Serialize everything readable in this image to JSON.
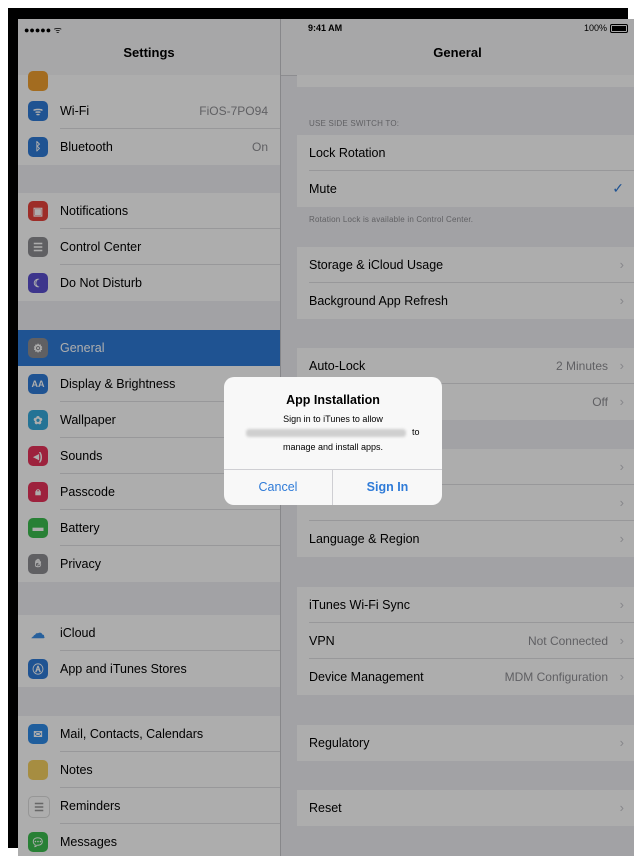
{
  "status": {
    "time": "9:41 AM",
    "battery": "100%"
  },
  "sidebar": {
    "title": "Settings",
    "wifi": {
      "label": "Wi-Fi",
      "value": "FiOS-7PO94"
    },
    "bluetooth": {
      "label": "Bluetooth",
      "value": "On"
    },
    "notifications": "Notifications",
    "control_center": "Control Center",
    "do_not_disturb": "Do Not Disturb",
    "general": "General",
    "display": "Display & Brightness",
    "wallpaper": "Wallpaper",
    "sounds": "Sounds",
    "passcode": "Passcode",
    "battery": "Battery",
    "privacy": "Privacy",
    "icloud": "iCloud",
    "app_stores": "App and iTunes Stores",
    "mail": "Mail, Contacts, Calendars",
    "notes": "Notes",
    "reminders": "Reminders",
    "messages": "Messages"
  },
  "main": {
    "title": "General",
    "side_switch_caption": "USE SIDE SWITCH TO:",
    "lock_rotation": "Lock Rotation",
    "mute": "Mute",
    "rotation_note": "Rotation Lock is available in Control Center.",
    "storage": "Storage & iCloud Usage",
    "background_refresh": "Background App Refresh",
    "auto_lock": {
      "label": "Auto-Lock",
      "value": "2 Minutes"
    },
    "restrictions": {
      "value": "Off"
    },
    "language": "Language & Region",
    "itunes_sync": "iTunes Wi-Fi Sync",
    "vpn": {
      "label": "VPN",
      "value": "Not Connected"
    },
    "device_mgmt": {
      "label": "Device Management",
      "value": "MDM Configuration"
    },
    "regulatory": "Regulatory",
    "reset": "Reset"
  },
  "dialog": {
    "title": "App Installation",
    "message_line1": "Sign in to iTunes to allow",
    "message_to": "to",
    "message_line2": "manage and install apps.",
    "cancel": "Cancel",
    "sign_in": "Sign In"
  },
  "colors": {
    "accent": "#2f7bd8",
    "background": "#efeff4"
  }
}
